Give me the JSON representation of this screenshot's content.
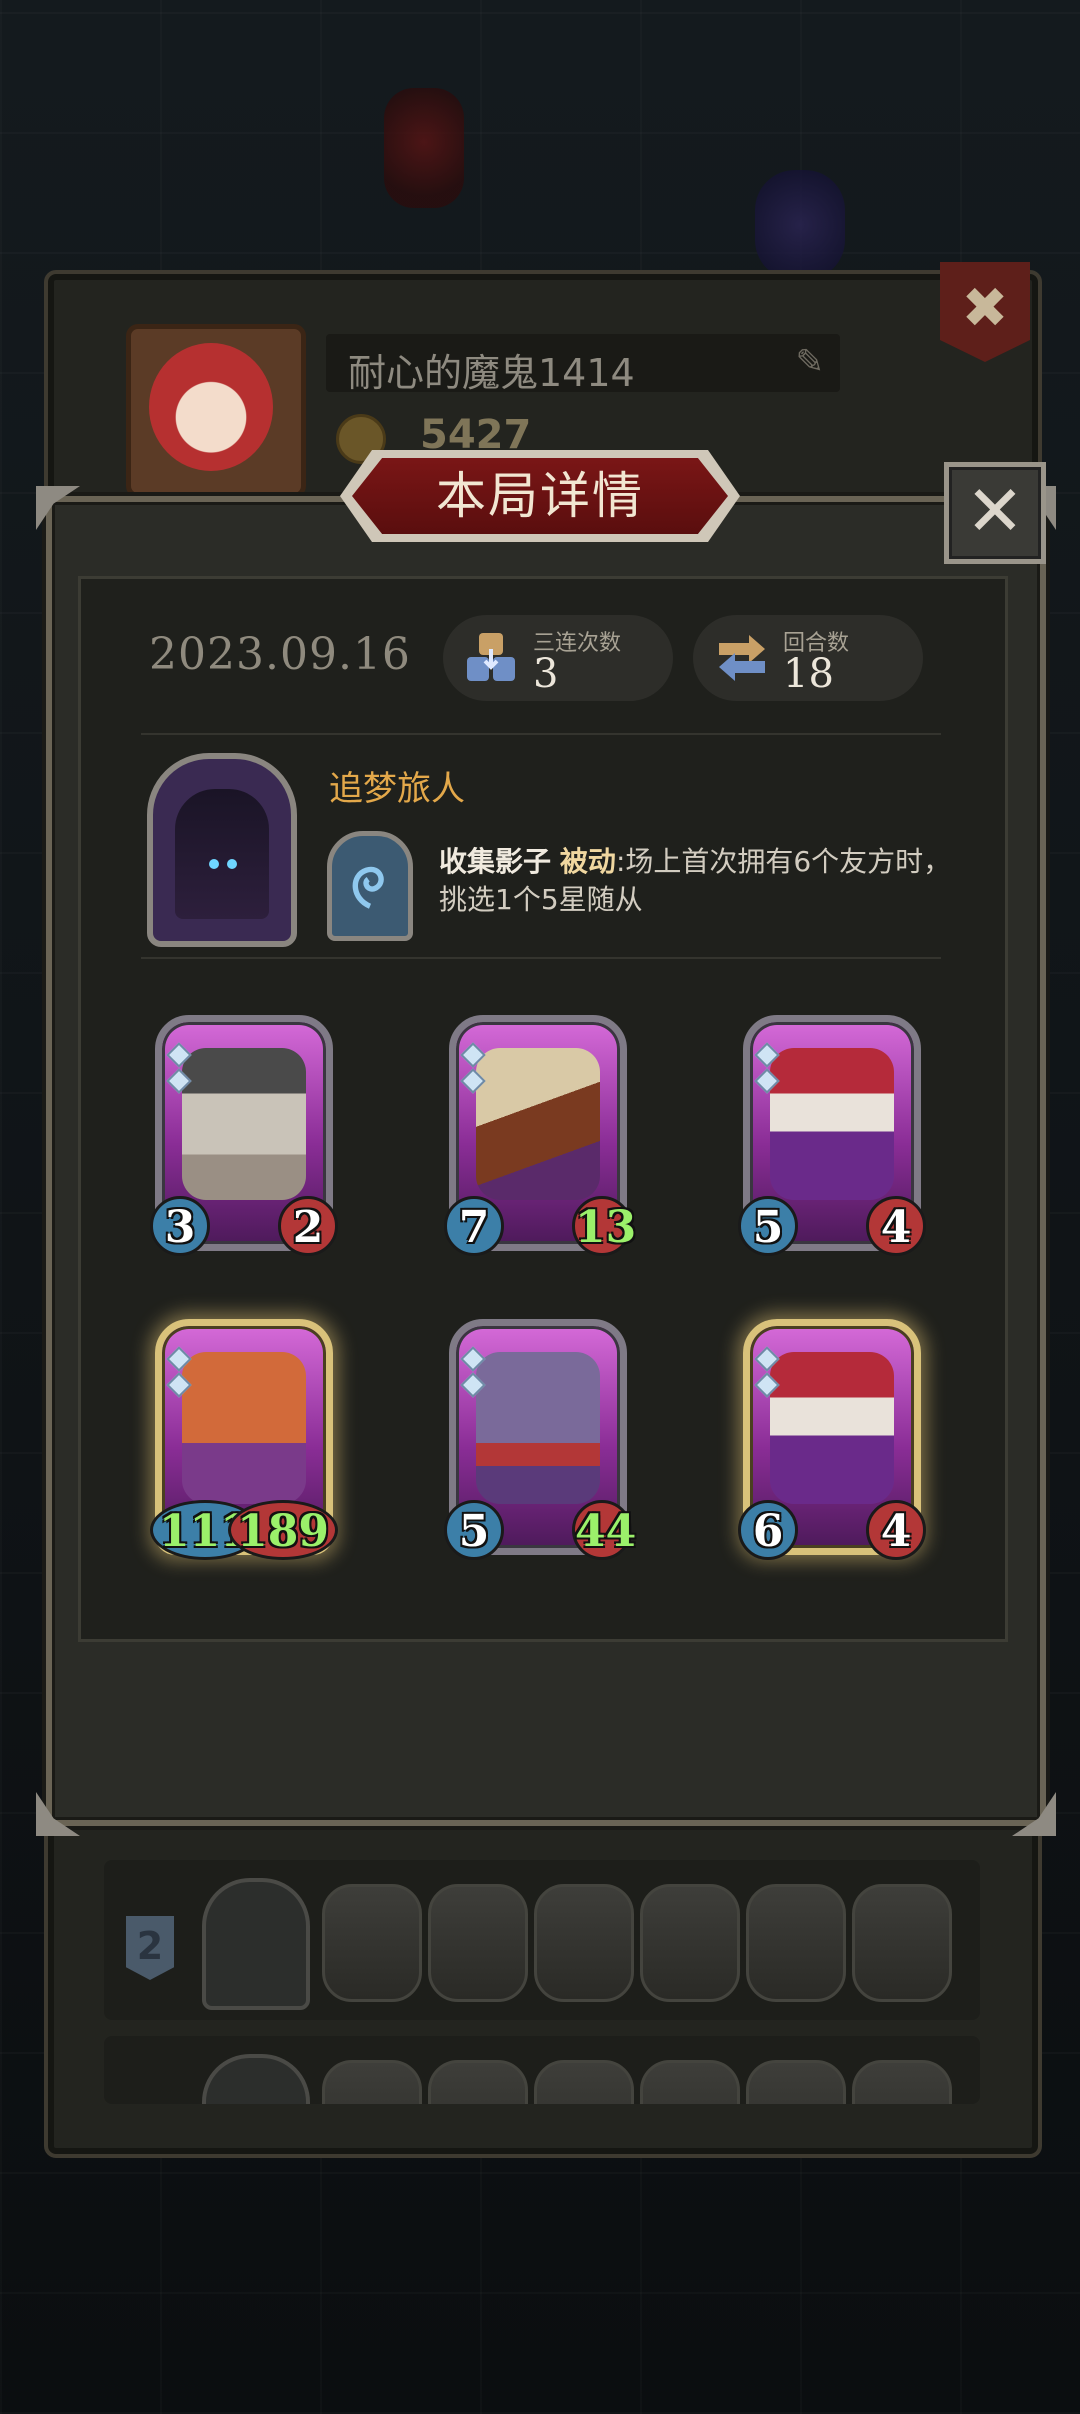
{
  "profile": {
    "player_name": "耐心的魔鬼1414",
    "coins": "5427",
    "rank_badge": "2",
    "close_symbol": "✖"
  },
  "modal": {
    "title": "本局详情",
    "close_symbol": "✕",
    "date": "2023.09.16",
    "triples_label": "三连次数",
    "triples_value": "3",
    "turns_label": "回合数",
    "turns_value": "18",
    "hero_name": "追梦旅人",
    "hero_power_name": "收集影子",
    "hero_power_type": "被动",
    "hero_power_desc": ":场上首次拥有6个友方时，挑选1个5星随从"
  },
  "minions": [
    {
      "atk": "3",
      "hp": "2",
      "golden": false,
      "atk_buff": false,
      "hp_buff": false,
      "icon": "robot-tophat-icon"
    },
    {
      "atk": "7",
      "hp": "13",
      "golden": false,
      "atk_buff": false,
      "hp_buff": true,
      "icon": "rocket-ship-icon"
    },
    {
      "atk": "5",
      "hp": "4",
      "golden": false,
      "atk_buff": false,
      "hp_buff": false,
      "icon": "clown-icon"
    },
    {
      "atk": "111",
      "hp": "189",
      "golden": true,
      "atk_buff": true,
      "hp_buff": true,
      "icon": "brick-golem-icon"
    },
    {
      "atk": "5",
      "hp": "44",
      "golden": false,
      "atk_buff": false,
      "hp_buff": true,
      "icon": "rat-bandit-icon"
    },
    {
      "atk": "6",
      "hp": "4",
      "golden": true,
      "atk_buff": false,
      "hp_buff": false,
      "icon": "clown-icon"
    }
  ],
  "colors": {
    "title_red": "#7a1616",
    "hero_name_orange": "#e3a84a",
    "attack_blue": "#3c7fa8",
    "health_red": "#b33737",
    "buff_green": "#9bf06a"
  }
}
